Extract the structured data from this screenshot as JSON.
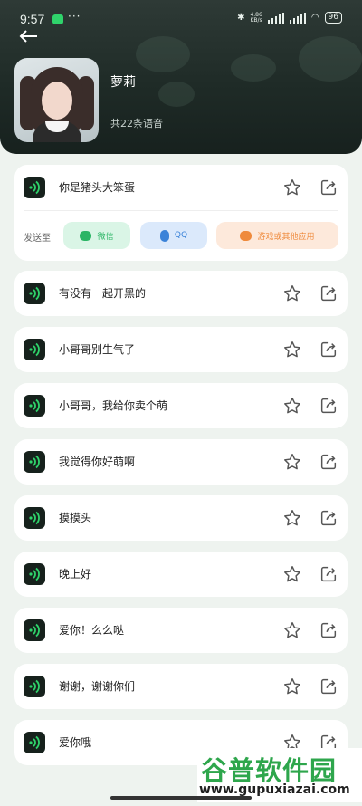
{
  "status": {
    "time": "9:57",
    "dots": "···",
    "speed": "4.86\nKB/s",
    "battery": "96"
  },
  "header": {
    "name": "萝莉",
    "count_text": "共22条语音"
  },
  "first_clip": "你是猪头大笨蛋",
  "send": {
    "label": "发送至",
    "targets": [
      "微信",
      "QQ",
      "游戏或其他应用"
    ]
  },
  "clips": [
    "有没有一起开黑的",
    "小哥哥别生气了",
    "小哥哥，我给你卖个萌",
    "我觉得你好萌啊",
    "摸摸头",
    "晚上好",
    "爱你！么么哒",
    "谢谢，谢谢你们",
    "爱你哦"
  ],
  "watermark": {
    "title": "谷普软件园",
    "url": "www.gupuxiazai.com"
  },
  "colors": {
    "accent": "#2fd36b",
    "dark": "#16211c",
    "header": "#1f2b27"
  }
}
